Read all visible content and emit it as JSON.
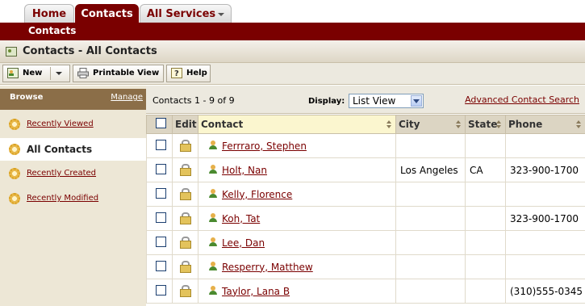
{
  "tabs": [
    {
      "label": "Home"
    },
    {
      "label": "Contacts"
    },
    {
      "label": "All Services"
    }
  ],
  "subnav": {
    "label": "Contacts"
  },
  "page": {
    "title": "Contacts - All Contacts"
  },
  "toolbar": {
    "new_label": "New",
    "print_label": "Printable View",
    "help_label": "Help"
  },
  "sidebar": {
    "browse_label": "Browse",
    "manage_label": "Manage",
    "items": [
      {
        "label": "Recently Viewed"
      },
      {
        "label": "All Contacts"
      },
      {
        "label": "Recently Created"
      },
      {
        "label": "Recently Modified"
      }
    ]
  },
  "list": {
    "record_count": "Contacts 1 - 9 of 9",
    "display_label": "Display:",
    "view_value": "List View",
    "advanced_search": "Advanced Contact Search",
    "columns": {
      "edit": "Edit",
      "contact": "Contact",
      "city": "City",
      "state": "State",
      "phone": "Phone"
    },
    "rows": [
      {
        "contact": "Ferrraro, Stephen",
        "city": "",
        "state": "",
        "phone": ""
      },
      {
        "contact": "Holt, Nan",
        "city": "Los Angeles",
        "state": "CA",
        "phone": "323-900-1700"
      },
      {
        "contact": "Kelly, Florence",
        "city": "",
        "state": "",
        "phone": ""
      },
      {
        "contact": "Koh, Tat",
        "city": "",
        "state": "",
        "phone": "323-900-1700"
      },
      {
        "contact": "Lee, Dan",
        "city": "",
        "state": "",
        "phone": ""
      },
      {
        "contact": "Resperry, Matthew",
        "city": "",
        "state": "",
        "phone": ""
      },
      {
        "contact": "Taylor, Lana B",
        "city": "",
        "state": "",
        "phone": "(310)555-0345"
      }
    ]
  }
}
